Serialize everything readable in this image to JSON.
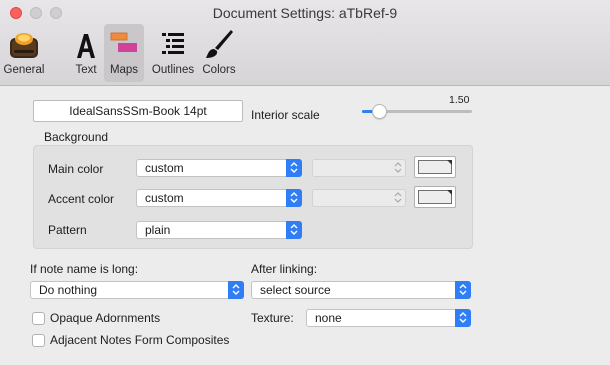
{
  "window": {
    "title": "Document Settings: aTbRef-9"
  },
  "toolbar": {
    "items": [
      {
        "label": "General",
        "icon": "app-icon"
      },
      {
        "label": "Text",
        "icon": "text-a-icon"
      },
      {
        "label": "Maps",
        "icon": "maps-icon"
      },
      {
        "label": "Outlines",
        "icon": "outline-list-icon"
      },
      {
        "label": "Colors",
        "icon": "paintbrush-icon"
      }
    ],
    "selected": "Maps"
  },
  "maps": {
    "font_button": "IdealSansSSm-Book 14pt",
    "interior_scale_label": "Interior scale",
    "interior_scale_value": "1.50",
    "interior_scale_fraction": 0.15,
    "background": {
      "label": "Background",
      "main_color_label": "Main color",
      "main_color_value": "custom",
      "accent_color_label": "Accent color",
      "accent_color_value": "custom",
      "pattern_label": "Pattern",
      "pattern_value": "plain"
    },
    "long_name_label": "If note name is long:",
    "long_name_value": "Do nothing",
    "after_linking_label": "After linking:",
    "after_linking_value": "select source",
    "opaque_adornments_label": "Opaque Adornments",
    "opaque_adornments_checked": false,
    "adjacent_notes_label": "Adjacent Notes Form Composites",
    "adjacent_notes_checked": false,
    "texture_label": "Texture:",
    "texture_value": "none"
  },
  "colors": {
    "accent": "#2f7ef6",
    "close": "#fc605c",
    "maps_icon_top": "#f08a3c",
    "maps_icon_bottom": "#d0439b"
  }
}
